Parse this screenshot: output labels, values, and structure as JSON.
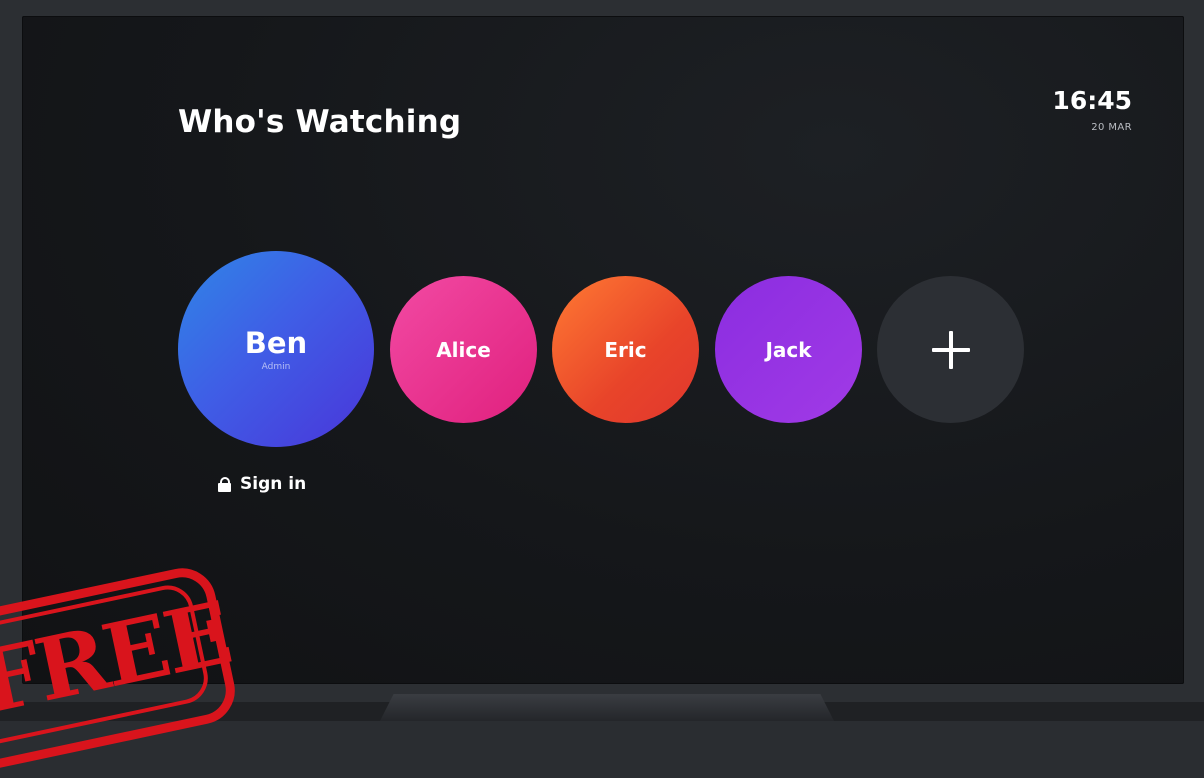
{
  "header": {
    "title": "Who's Watching",
    "time": "16:45",
    "date": "20 MAR"
  },
  "profiles": [
    {
      "name": "Ben",
      "role": "Admin",
      "color_from": "#2f86e6",
      "color_to": "#4a35d9"
    },
    {
      "name": "Alice",
      "color_from": "#f24aa3",
      "color_to": "#e0207e"
    },
    {
      "name": "Eric",
      "color_from": "#ff7a33",
      "color_to": "#e1372e"
    },
    {
      "name": "Jack",
      "color_from": "#8b2de0",
      "color_to": "#a13ae6"
    }
  ],
  "add_profile": {
    "icon": "plus-icon"
  },
  "signin": {
    "label": "Sign in",
    "icon": "lock-icon"
  },
  "stamp": {
    "text": "FREE",
    "color": "#d9141c"
  },
  "colors": {
    "background": "#15171a",
    "add_circle": "#2c2f34",
    "text": "#ffffff"
  }
}
